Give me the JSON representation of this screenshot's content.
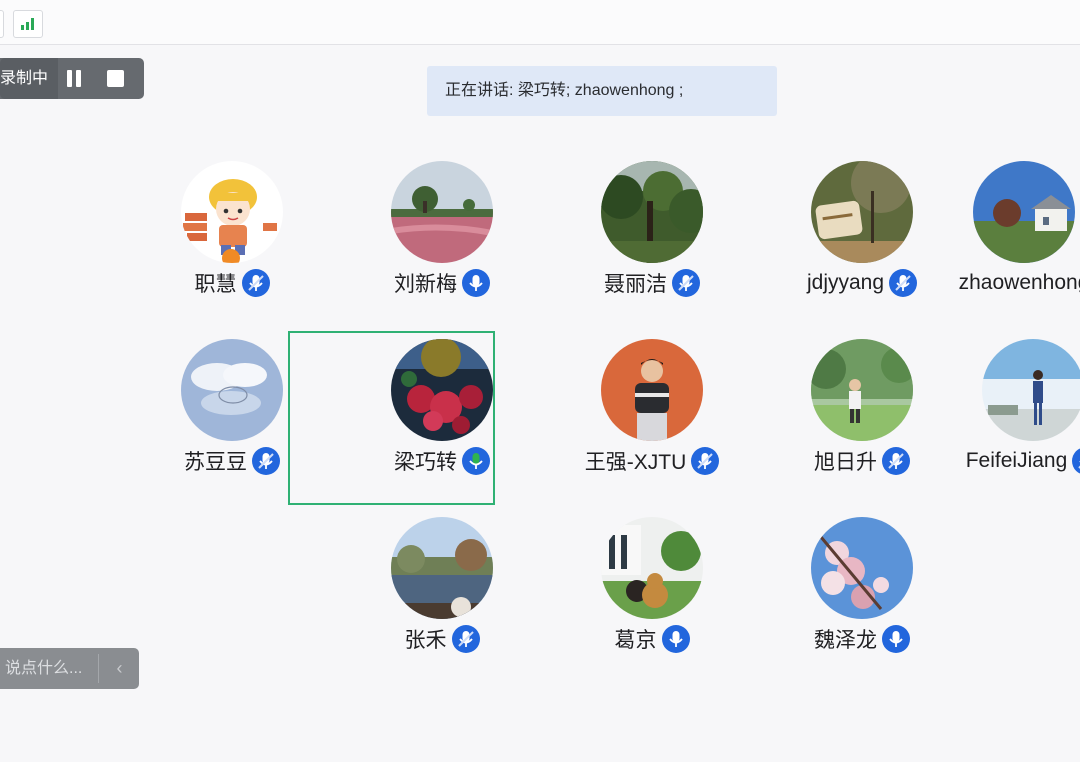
{
  "record": {
    "label": "录制中"
  },
  "speaking": {
    "prefix": "正在讲话: ",
    "names": "梁巧转; zhaowenhong ;"
  },
  "colors": {
    "mic_blue": "#2266dd",
    "mic_active": "#2fb34f",
    "highlight": "#2fb174"
  },
  "participants": [
    {
      "name": "职慧",
      "mic": "muted",
      "avatar_icon": "cartoon-girl-avatar"
    },
    {
      "name": "刘新梅",
      "mic": "on",
      "avatar_icon": "flower-field-avatar"
    },
    {
      "name": "聂丽洁",
      "mic": "muted",
      "avatar_icon": "forest-avatar"
    },
    {
      "name": "jdjyyang",
      "mic": "muted",
      "avatar_icon": "stone-sign-avatar"
    },
    {
      "name": "zhaowenhong",
      "mic": "muted",
      "avatar_icon": "house-avatar"
    },
    {
      "name": "苏豆豆",
      "mic": "muted",
      "avatar_icon": "sky-clouds-avatar"
    },
    {
      "name": "梁巧转",
      "mic": "speaking",
      "avatar_icon": "red-flowers-avatar"
    },
    {
      "name": "王强-XJTU",
      "mic": "muted",
      "avatar_icon": "person-portrait-avatar"
    },
    {
      "name": "旭日升",
      "mic": "muted",
      "avatar_icon": "park-child-avatar"
    },
    {
      "name": "FeifeiJiang",
      "mic": "muted",
      "avatar_icon": "beach-person-avatar"
    },
    {
      "name": "张禾",
      "mic": "muted",
      "avatar_icon": "lake-avatar"
    },
    {
      "name": "葛京",
      "mic": "on",
      "avatar_icon": "teddy-bear-avatar"
    },
    {
      "name": "魏泽龙",
      "mic": "on",
      "avatar_icon": "blossom-avatar"
    }
  ],
  "chat": {
    "placeholder": "说点什么..."
  }
}
